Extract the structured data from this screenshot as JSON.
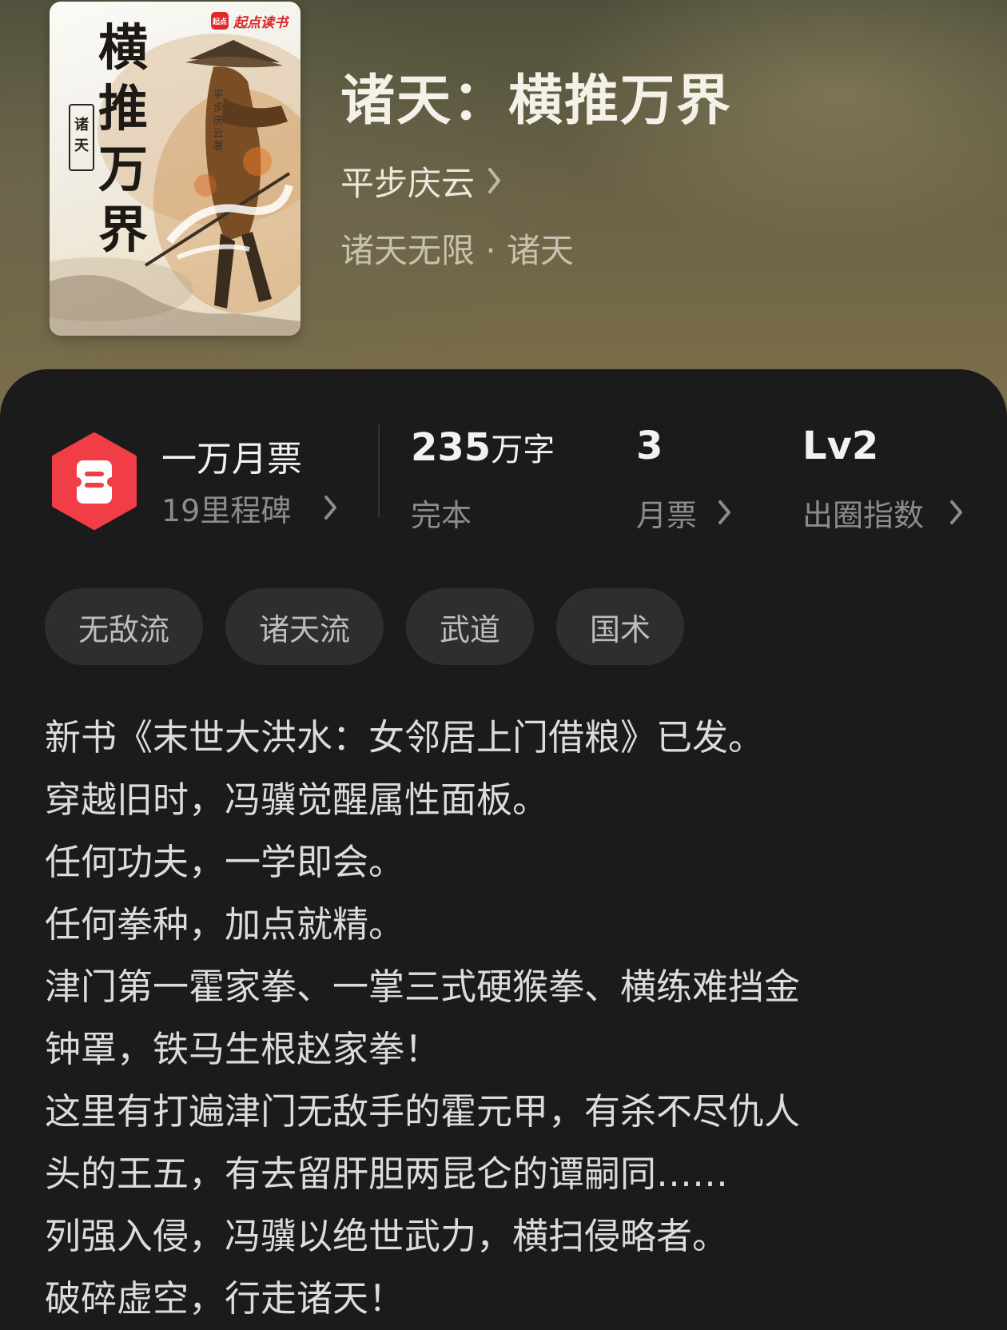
{
  "book": {
    "title": "诸天：横推万界",
    "author": "平步庆云",
    "category": "诸天无限 · 诸天"
  },
  "cover": {
    "publisher": "起点读书",
    "publisher_logo": "起点",
    "title": "横推万界",
    "side_tag": "诸天",
    "author_line": "平步庆云 著"
  },
  "stats": {
    "ticket_title": "一万月票",
    "ticket_sub": "19里程碑",
    "words_value": "235",
    "words_unit": "万字",
    "words_status": "完本",
    "monthly_value": "3",
    "monthly_label": "月票",
    "index_value": "Lv2",
    "index_label": "出圈指数"
  },
  "tags": [
    "无敌流",
    "诸天流",
    "武道",
    "国术"
  ],
  "description": [
    "新书《末世大洪水：女邻居上门借粮》已发。",
    "穿越旧时，冯骥觉醒属性面板。",
    "任何功夫，一学即会。",
    "任何拳种，加点就精。",
    "津门第一霍家拳、一掌三式硬猴拳、横练难挡金",
    "钟罩，铁马生根赵家拳！",
    "这里有打遍津门无敌手的霍元甲，有杀不尽仇人",
    "头的王五，有去留肝胆两昆仑的谭嗣同……",
    "列强入侵，冯骥以绝世武力，横扫侵略者。",
    "破碎虚空，行走诸天！"
  ],
  "colors": {
    "accent_red": "#f03d46",
    "panel_bg": "#1b1b1b",
    "tag_bg": "#2e2e2e"
  },
  "icons": [
    "chevron-right-icon",
    "monthly-ticket-icon"
  ]
}
